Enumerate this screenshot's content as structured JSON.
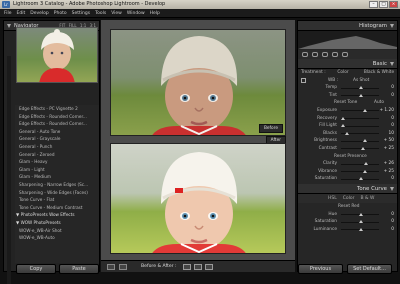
{
  "window": {
    "title": "Lightroom 3 Catalog - Adobe Photoshop Lightroom - Develop",
    "app_badge": "Lr"
  },
  "menu": [
    "File",
    "Edit",
    "Develop",
    "Photo",
    "Settings",
    "Tools",
    "View",
    "Window",
    "Help"
  ],
  "navigator": {
    "title": "Navigator",
    "zoom_levels": [
      "FIT",
      "FILL",
      "1:1",
      "3:1"
    ]
  },
  "presets": [
    {
      "label": "Edge Effects - PC Vignette 2",
      "folder": false
    },
    {
      "label": "Edge Effects - Rounded Corner...",
      "folder": false
    },
    {
      "label": "Edge Effects - Rounded Corner...",
      "folder": false
    },
    {
      "label": "General - Auto Tone",
      "folder": false
    },
    {
      "label": "General - Grayscale",
      "folder": false
    },
    {
      "label": "General - Punch",
      "folder": false
    },
    {
      "label": "General - Zeroed",
      "folder": false
    },
    {
      "label": "Glam - Heavy",
      "folder": false
    },
    {
      "label": "Glam - Light",
      "folder": false
    },
    {
      "label": "Glam - Medium",
      "folder": false
    },
    {
      "label": "Sharpening - Narrow Edges (Sc...",
      "folder": false
    },
    {
      "label": "Sharpening - Wide Edges (Faces)",
      "folder": false
    },
    {
      "label": "Tone Curve - Flat",
      "folder": false
    },
    {
      "label": "Tone Curve - Medium Contrast",
      "folder": false
    },
    {
      "label": "PhotoPresets Wow Effects",
      "folder": true
    },
    {
      "label": "WOW PhotoPresets",
      "folder": true
    },
    {
      "label": "WOW-e_WB-Air Shot",
      "folder": false
    },
    {
      "label": "WOW-e_WB-Auto",
      "folder": false
    }
  ],
  "left_buttons": {
    "copy": "Copy",
    "paste": "Paste"
  },
  "center": {
    "before_label": "Before",
    "after_label": "After",
    "compare_label": "Before & After :"
  },
  "right": {
    "histogram_title": "Histogram",
    "basic_title": "Basic",
    "treatment_label": "Treatment :",
    "treatment_color": "Color",
    "treatment_bw": "Black & White",
    "wb_label": "WB :",
    "wb_value": "As Shot",
    "temp_label": "Temp",
    "temp_value": "0",
    "tint_label": "Tint",
    "tint_value": "0",
    "tone_label": "Reset Tone",
    "tone_auto": "Auto",
    "exposure_label": "Exposure",
    "exposure_value": "+ 1.20",
    "recovery_label": "Recovery",
    "recovery_value": "0",
    "fill_label": "Fill Light",
    "fill_value": "0",
    "blacks_label": "Blacks",
    "blacks_value": "10",
    "brightness_label": "Brightness",
    "brightness_value": "+ 50",
    "contrast_label": "Contrast",
    "contrast_value": "+ 25",
    "presence_label": "Reset Presence",
    "clarity_label": "Clarity",
    "clarity_value": "+ 26",
    "vibrance_label": "Vibrance",
    "vibrance_value": "+ 25",
    "saturation_label": "Saturation",
    "saturation_value": "0",
    "tone_curve_title": "Tone Curve",
    "hsl_tabs": [
      "HSL",
      "Color",
      "B & W"
    ],
    "hsl_reset": "Reset Red",
    "hue_label": "Hue",
    "hue_value": "0",
    "sat_label": "Saturation",
    "sat_value": "0",
    "lum_label": "Luminance",
    "lum_value": "0",
    "previous_button": "Previous",
    "reset_button": "Set Default..."
  }
}
